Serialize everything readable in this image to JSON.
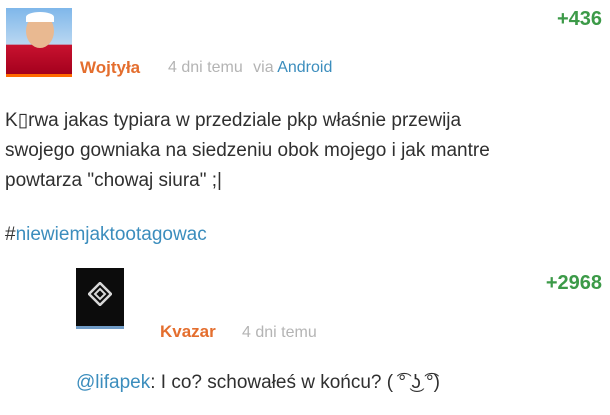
{
  "post": {
    "author": "Wojtyła",
    "time": "4 dni temu",
    "via_label": "via",
    "client": "Android",
    "votes": "+436",
    "lines": [
      "K▯rwa jakas typiara w przedziale pkp właśnie przewija",
      "swojego gowniaka na siedzeniu obok mojego i jak mantre",
      "powtarza \"chowaj siura\" ;|"
    ],
    "hashtag_symbol": "#",
    "hashtag": "niewiemjaktootagowac",
    "avatar_icon": "portrait-avatar",
    "username_color": "#e46e2e",
    "votes_color": "#3c9a48",
    "link_color": "#3b8dbd"
  },
  "comment": {
    "author": "Kvazar",
    "time": "4 dni temu",
    "votes": "+2968",
    "mention": "@lifapek",
    "text": ": I co? schowałeś w końcu? ( ͡° ͜ʖ ͡°)",
    "avatar_icon": "diamond-logo-avatar"
  }
}
